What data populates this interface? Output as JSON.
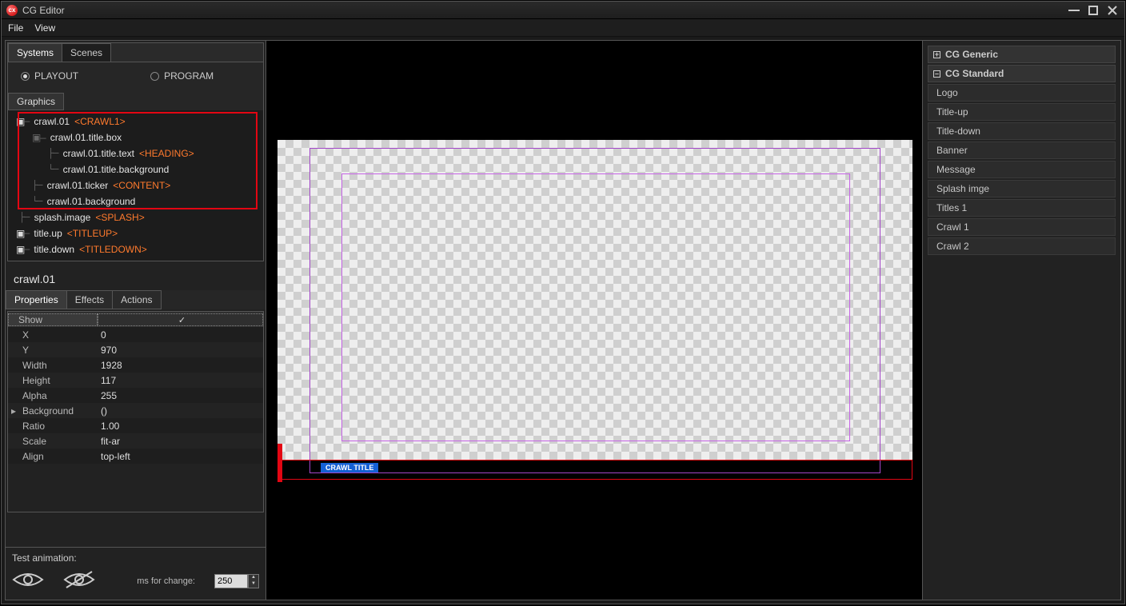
{
  "window": {
    "title": "CG Editor"
  },
  "menubar": {
    "file": "File",
    "view": "View"
  },
  "left": {
    "tabs": {
      "systems": "Systems",
      "scenes": "Scenes"
    },
    "radios": {
      "playout": "PLAYOUT",
      "program": "PROGRAM"
    },
    "graphics_tab": "Graphics",
    "tree": {
      "r0": {
        "label": "crawl.01",
        "tag": "<CRAWL1>"
      },
      "r1": {
        "label": "crawl.01.title.box"
      },
      "r2": {
        "label": "crawl.01.title.text",
        "tag": "<HEADING>"
      },
      "r3": {
        "label": "crawl.01.title.background"
      },
      "r4": {
        "label": "crawl.01.ticker",
        "tag": "<CONTENT>"
      },
      "r5": {
        "label": "crawl.01.background"
      },
      "r6": {
        "label": "splash.image",
        "tag": "<SPLASH>"
      },
      "r7": {
        "label": "title.up",
        "tag": "<TITLEUP>"
      },
      "r8": {
        "label": "title.down",
        "tag": "<TITLEDOWN>"
      }
    },
    "selected": "crawl.01",
    "prop_tabs": {
      "properties": "Properties",
      "effects": "Effects",
      "actions": "Actions"
    },
    "props": {
      "show_k": "Show",
      "x_k": "X",
      "x_v": "0",
      "y_k": "Y",
      "y_v": "970",
      "w_k": "Width",
      "w_v": "1928",
      "h_k": "Height",
      "h_v": "117",
      "a_k": "Alpha",
      "a_v": "255",
      "bg_k": "Background",
      "bg_v": "()",
      "r_k": "Ratio",
      "r_v": "1.00",
      "s_k": "Scale",
      "s_v": "fit-ar",
      "al_k": "Align",
      "al_v": "top-left"
    },
    "test_anim": {
      "title": "Test animation:",
      "ms_label": "ms for change:",
      "ms_value": "250"
    }
  },
  "right": {
    "g0": "CG Generic",
    "g1": "CG Standard",
    "items": {
      "i0": "Logo",
      "i1": "Title-up",
      "i2": "Title-down",
      "i3": "Banner",
      "i4": "Message",
      "i5": "Splash imge",
      "i6": "Titles 1",
      "i7": "Crawl 1",
      "i8": "Crawl 2"
    }
  },
  "canvas": {
    "crawl_title": "CRAWL TITLE"
  }
}
